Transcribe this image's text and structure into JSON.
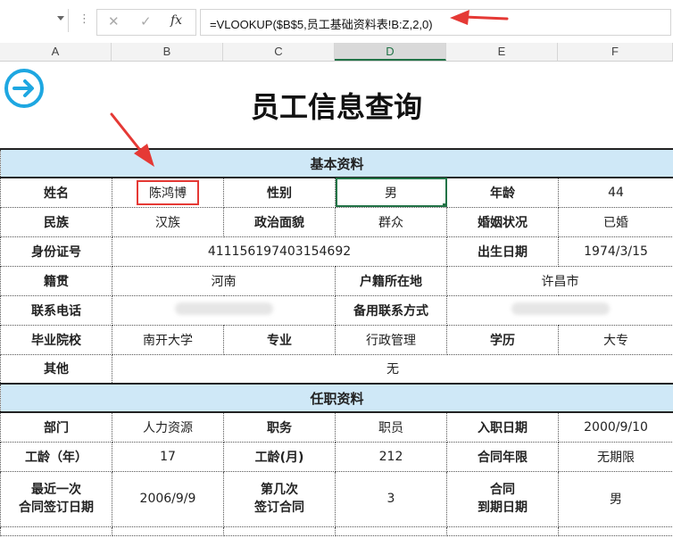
{
  "formula_bar": {
    "formula": "=VLOOKUP($B$5,员工基础资料表!B:Z,2,0)",
    "cancel_symbol": "✕",
    "enter_symbol": "✓",
    "fx_symbol": "fx",
    "more_symbol": "⋮"
  },
  "columns": [
    "A",
    "B",
    "C",
    "D",
    "E",
    "F"
  ],
  "sheet": {
    "title": "员工信息查询",
    "section_basic": "基本资料",
    "section_job": "任职资料",
    "basic": {
      "name_label": "姓名",
      "name_value": "陈鸿博",
      "gender_label": "性别",
      "gender_value": "男",
      "age_label": "年龄",
      "age_value": "44",
      "ethnic_label": "民族",
      "ethnic_value": "汉族",
      "political_label": "政治面貌",
      "political_value": "群众",
      "marital_label": "婚姻状况",
      "marital_value": "已婚",
      "idcard_label": "身份证号",
      "idcard_value": "411156197403154692",
      "birth_label": "出生日期",
      "birth_value": "1974/3/15",
      "native_label": "籍贯",
      "native_value": "河南",
      "household_label": "户籍所在地",
      "household_value": "许昌市",
      "phone_label": "联系电话",
      "backup_label": "备用联系方式",
      "school_label": "毕业院校",
      "school_value": "南开大学",
      "major_label": "专业",
      "major_value": "行政管理",
      "edu_label": "学历",
      "edu_value": "大专",
      "other_label": "其他",
      "other_value": "无"
    },
    "job": {
      "dept_label": "部门",
      "dept_value": "人力资源",
      "position_label": "职务",
      "position_value": "职员",
      "hire_label": "入职日期",
      "hire_value": "2000/9/10",
      "years_label": "工龄（年）",
      "years_value": "17",
      "months_label": "工龄(月)",
      "months_value": "212",
      "contract_label": "合同年限",
      "contract_value": "无期限",
      "recent_label_1": "最近一次",
      "recent_label_2": "合同签订日期",
      "recent_value": "2006/9/9",
      "nth_label_1": "第几次",
      "nth_label_2": "签订合同",
      "nth_value": "3",
      "expire_label_1": "合同",
      "expire_label_2": "到期日期",
      "expire_value": "男"
    }
  },
  "colors": {
    "accent_green": "#217346",
    "section_fill": "#cfe8f7",
    "annotation_red": "#e53935",
    "arrow_icon_blue": "#1ea7e1"
  }
}
